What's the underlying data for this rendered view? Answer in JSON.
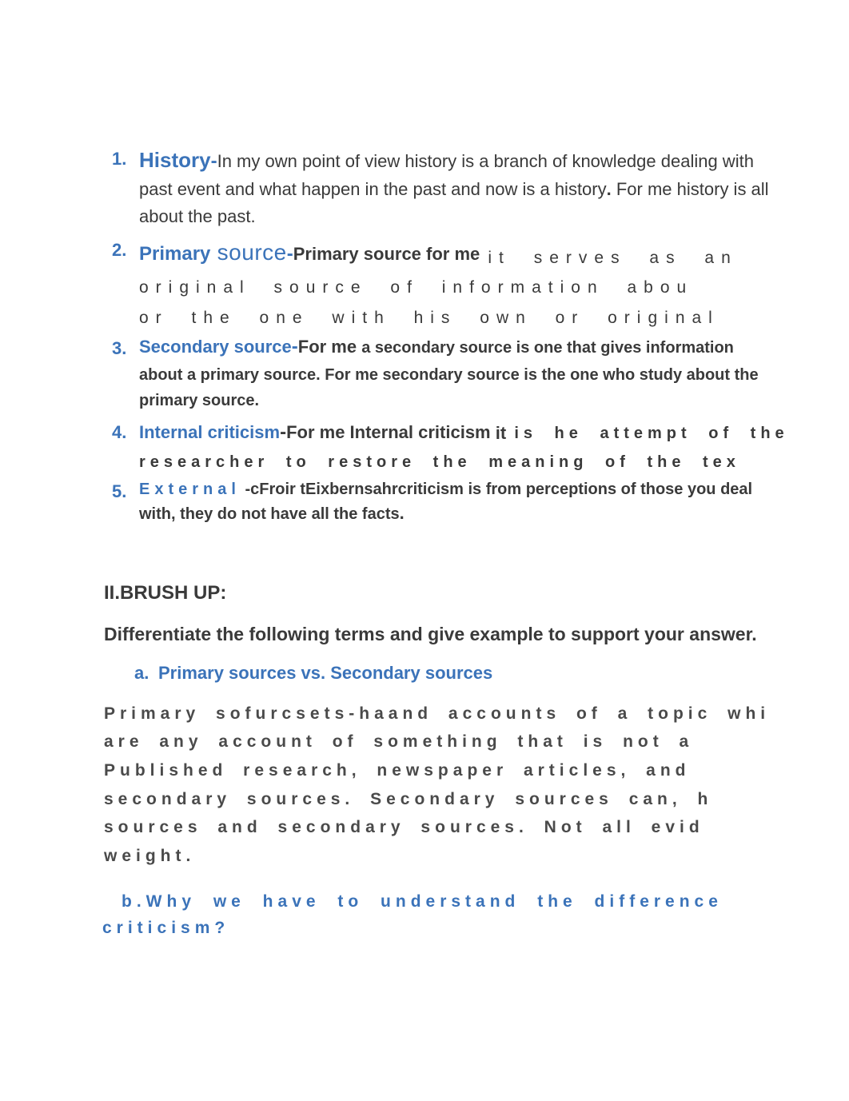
{
  "items": {
    "n1": "1.",
    "n2": "2.",
    "n3": "3.",
    "n4": "4.",
    "n5": "5.",
    "history_term": "History",
    "history_dash": "-",
    "history_body_1": "In my own point of view history is a branch of knowledge dealing with past event and what happen in the past and now is a history",
    "history_dot": ".",
    "history_body_2": " For me history is all about the past.",
    "primary_term": "Primary",
    "source_word": " source",
    "primary_dash": "-",
    "primary_lead": "Primary source for me",
    "primary_spaced_1": "it serves as an",
    "primary_spaced_2": "original source of information abou",
    "primary_spaced_3": "or the one with his own or original",
    "secondary_term": "Secondary source",
    "secondary_dash": "-",
    "secondary_lead": "For me ",
    "secondary_body": "a secondary source is one that gives information about a primary source. For me secondary source is the one who study about the primary source.",
    "internal_term": "Internal criticism",
    "internal_dash": "-",
    "internal_lead1": "For me ",
    "internal_lead2": "Internal criticism ",
    "internal_it": "it",
    "internal_spaced_1": "is he attempt of the",
    "internal_spaced_2": "researcher to restore the meaning of the tex",
    "external_term": "External",
    "external_mid": " -cFroir tEixbernsahr",
    "external_lead": "criticism is from perceptions of those you deal with, they do not have all the facts",
    "external_dot": "."
  },
  "section2": {
    "head": "II.BRUSH UP:",
    "sub": "Differentiate the following terms and give example to support your answer.",
    "a_letter": "a.",
    "a_text": "Primary sources vs. Secondary sources",
    "para": [
      "Primary sofurcsets-haand accounts of a topic whi",
      "are any account of something that is not a ",
      "Published research, newspaper articles, and",
      "secondary sources. Secondary sources can, h",
      "sources and secondary sources. Not all evid",
      "weight."
    ],
    "b_prefix": "b.",
    "b_text": "Why we have to understand the difference",
    "b_text2": "criticism?"
  }
}
